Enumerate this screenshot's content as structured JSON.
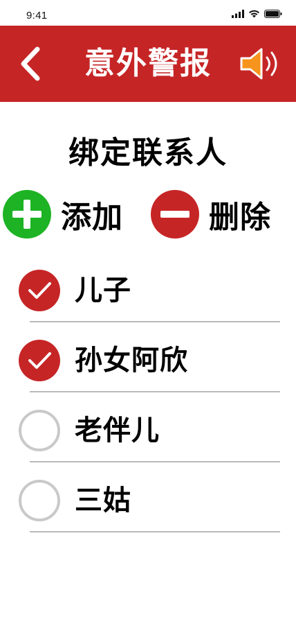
{
  "status_bar": {
    "time": "9:41"
  },
  "header": {
    "title": "意外警报",
    "back_icon": "chevron-left-icon",
    "speaker_icon": "speaker-volume-icon",
    "background_color": "#c62526",
    "speaker_color": "#f7941d"
  },
  "section": {
    "title": "绑定联系人"
  },
  "actions": {
    "add_label": "添加",
    "add_color": "#1db324",
    "delete_label": "删除",
    "delete_color": "#c62526"
  },
  "contacts": [
    {
      "name": "儿子",
      "checked": true
    },
    {
      "name": "孙女阿欣",
      "checked": true
    },
    {
      "name": "老伴儿",
      "checked": false
    },
    {
      "name": "三姑",
      "checked": false
    }
  ]
}
